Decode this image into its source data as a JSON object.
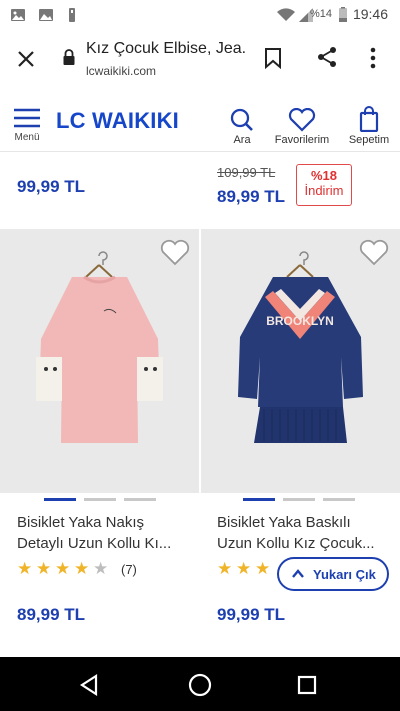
{
  "status_bar": {
    "battery_percent": "%14",
    "time": "19:46"
  },
  "browser": {
    "page_title": "Kız Çocuk Elbise, Jea...",
    "url": "lcwaikiki.com"
  },
  "header": {
    "menu_label": "Menü",
    "logo_text": "LC WAIKIKI",
    "search_label": "Ara",
    "favorites_label": "Favorilerim",
    "cart_label": "Sepetim"
  },
  "top_row": {
    "left_price": "99,99 TL",
    "right_old_price": "109,99 TL",
    "right_price": "89,99 TL",
    "discount_percent": "%18",
    "discount_label": "İndirim"
  },
  "products": [
    {
      "name_line1": "Bisiklet Yaka Nakış",
      "name_line2": "Detaylı Uzun Kollu Kı...",
      "rating": 4,
      "rating_count": "(7)",
      "price": "89,99 TL"
    },
    {
      "name_line1": "Bisiklet Yaka Baskılı",
      "name_line2": "Uzun Kollu Kız Çocuk...",
      "rating": 3,
      "price": "99,99 TL",
      "print_text": "BROOKLYN"
    }
  ],
  "scroll_top_button": {
    "label": "Yukarı Çık"
  },
  "colors": {
    "brand_blue": "#1d3fb0",
    "discount_red": "#e03030",
    "star_gold": "#f0b429"
  }
}
